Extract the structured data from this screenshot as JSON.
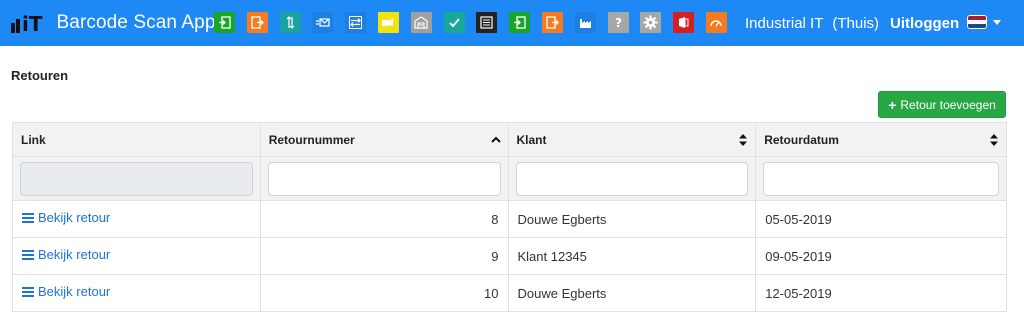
{
  "navbar": {
    "logo_text": "iT",
    "title": "Barcode Scan App",
    "icons": [
      {
        "name": "inbound-icon",
        "color": "#1aa52a"
      },
      {
        "name": "outbound-icon",
        "color": "#f47b20"
      },
      {
        "name": "transfer-icon",
        "color": "#1aa2a2"
      },
      {
        "name": "shipment-icon",
        "color": "#1e7fe0"
      },
      {
        "name": "exchange-icon",
        "color": "#1e7fe0"
      },
      {
        "name": "stock-icon",
        "color": "#f2e20e"
      },
      {
        "name": "warehouse-icon",
        "color": "#a0a0a0"
      },
      {
        "name": "check-icon",
        "color": "#18a89a"
      },
      {
        "name": "list-icon",
        "color": "#222222"
      },
      {
        "name": "receive-icon",
        "color": "#1aa52a"
      },
      {
        "name": "return-out-icon",
        "color": "#f47b20"
      },
      {
        "name": "factory-icon",
        "color": "#1e7fe0"
      },
      {
        "name": "help-icon",
        "color": "#a7a7a7"
      },
      {
        "name": "settings-icon",
        "color": "#a7a7a7"
      },
      {
        "name": "office-icon",
        "color": "#d42020"
      },
      {
        "name": "dashboard-icon",
        "color": "#f47b20"
      }
    ],
    "company": "Industrial IT",
    "location": "(Thuis)",
    "logout_label": "Uitloggen",
    "language_flag": "flag-nl-icon"
  },
  "page": {
    "title": "Retouren",
    "add_button_label": "Retour toevoegen"
  },
  "table": {
    "columns": [
      "Link",
      "Retournummer",
      "Klant",
      "Retourdatum"
    ],
    "rows": [
      {
        "link": "Bekijk retour",
        "nummer": "8",
        "klant": "Douwe Egberts",
        "datum": "05-05-2019"
      },
      {
        "link": "Bekijk retour",
        "nummer": "9",
        "klant": "Klant 12345",
        "datum": "09-05-2019"
      },
      {
        "link": "Bekijk retour",
        "nummer": "10",
        "klant": "Douwe Egberts",
        "datum": "12-05-2019"
      }
    ]
  }
}
